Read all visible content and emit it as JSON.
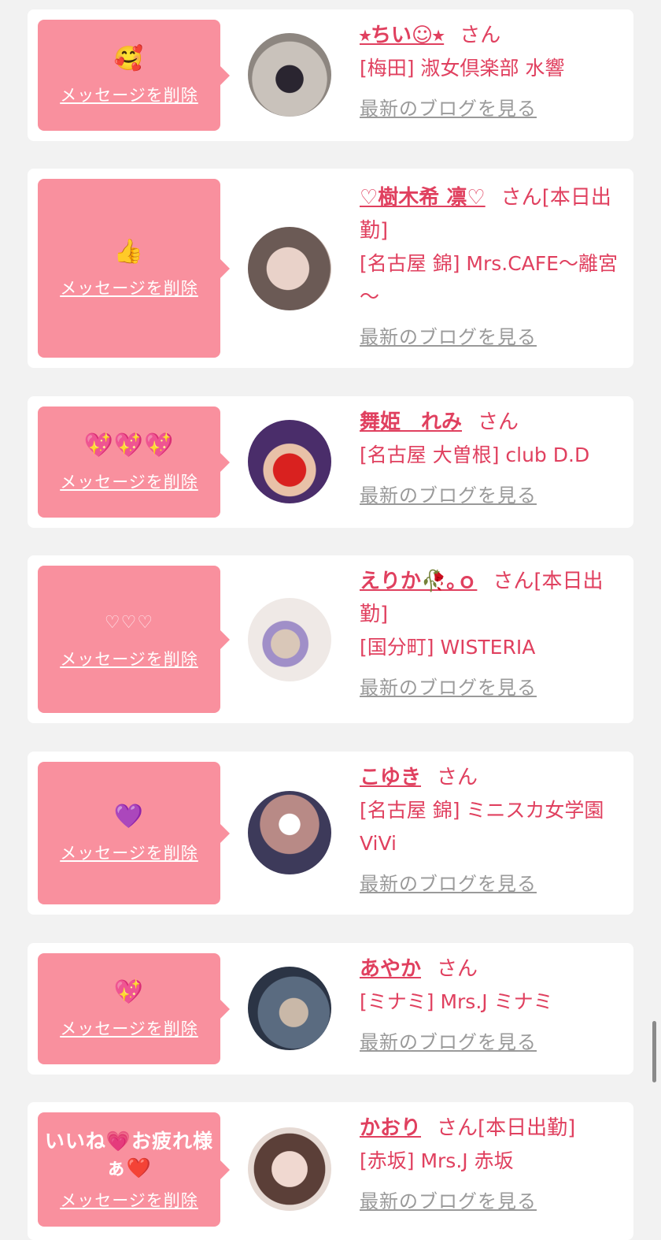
{
  "delete_label": "メッセージを削除",
  "blog_label": "最新のブログを見る",
  "san_label": "さん",
  "items": [
    {
      "message": "🥰",
      "name": "⭒ちい☺︎⭒",
      "status": "",
      "shop": "[梅田] 淑女倶楽部 水響"
    },
    {
      "message": "👍",
      "name": "♡樹木希 凛♡",
      "status": "[本日出勤]",
      "shop": "[名古屋 錦] Mrs.CAFE～離宮～"
    },
    {
      "message": "💖💖💖",
      "name": "舞姫　れみ",
      "status": "",
      "shop": "[名古屋 大曽根] club D.D"
    },
    {
      "message": "♡♡♡",
      "name": "えりか🥀｡ｏ",
      "status": "[本日出勤]",
      "shop": "[国分町] WISTERIA"
    },
    {
      "message": "💜",
      "name": "こゆき",
      "status": "",
      "shop": "[名古屋 錦] ミニスカ女学園ViVi"
    },
    {
      "message": "💖",
      "name": "あやか",
      "status": "",
      "shop": "[ミナミ] Mrs.J ミナミ"
    },
    {
      "message": "いいね💗お疲れ様ぁ❤️",
      "name": "かおり",
      "status": "[本日出勤]",
      "shop": "[赤坂] Mrs.J 赤坂"
    }
  ]
}
